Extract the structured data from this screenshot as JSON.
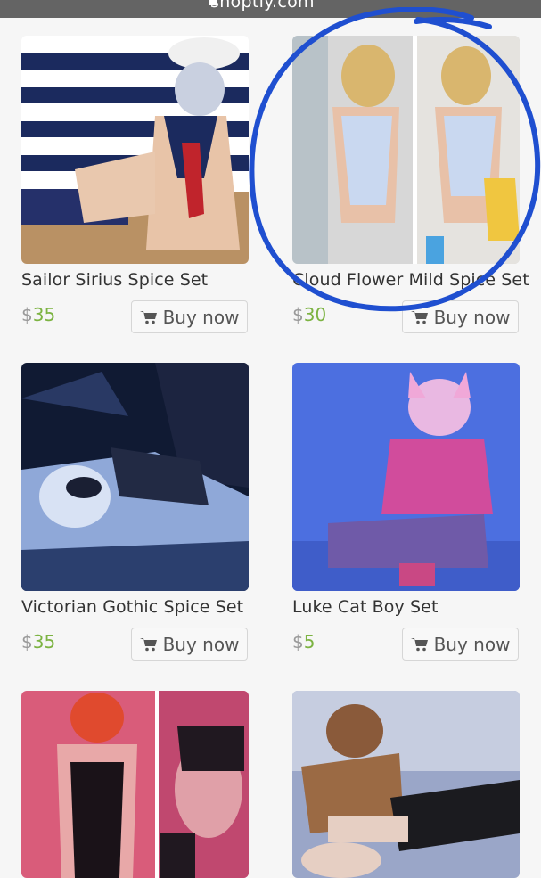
{
  "browser": {
    "url": "shoptly.com"
  },
  "products": [
    {
      "title": "Sailor Sirius Spice Set",
      "currency": "$",
      "price": "35",
      "buy_label": "Buy now",
      "image": "sailor costume photo"
    },
    {
      "title": "Cloud Flower Mild Spice Set",
      "currency": "$",
      "price": "30",
      "buy_label": "Buy now",
      "image": "lace bodysuit photo"
    },
    {
      "title": "Victorian Gothic Spice Set",
      "currency": "$",
      "price": "35",
      "buy_label": "Buy now",
      "image": "gothic lace photo"
    },
    {
      "title": "Luke Cat Boy Set",
      "currency": "$",
      "price": "5",
      "buy_label": "Buy now",
      "image": "cat boy photo"
    },
    {
      "title": "",
      "currency": "",
      "price": "",
      "buy_label": "",
      "image": "red lace photo"
    },
    {
      "title": "",
      "currency": "",
      "price": "",
      "buy_label": "",
      "image": "bear hoodie photo"
    }
  ],
  "icons": {
    "buy": "cart-icon"
  },
  "colors": {
    "price": "#7cb342",
    "annotation": "#1f4fd0"
  }
}
